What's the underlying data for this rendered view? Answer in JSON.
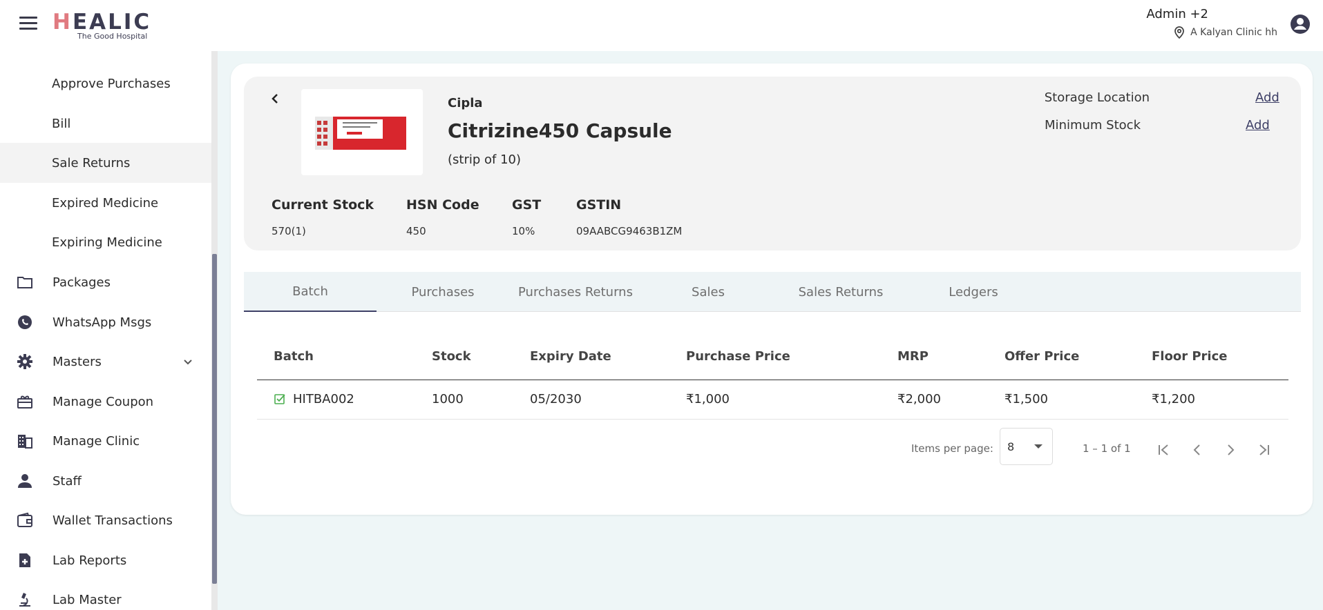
{
  "header": {
    "brand": "HEALIC",
    "tagline": "The Good Hospital",
    "user_name": "Admin +2",
    "location": "A Kalyan Clinic hh"
  },
  "sidebar": {
    "items": [
      {
        "label": "Approve Purchases",
        "icon": null
      },
      {
        "label": "Bill",
        "icon": null
      },
      {
        "label": "Sale Returns",
        "icon": null,
        "active": true
      },
      {
        "label": "Expired Medicine",
        "icon": null
      },
      {
        "label": "Expiring Medicine",
        "icon": null
      },
      {
        "label": "Packages",
        "icon": "folder-icon"
      },
      {
        "label": "WhatsApp Msgs",
        "icon": "whatsapp-icon"
      },
      {
        "label": "Masters",
        "icon": "gear-icon",
        "expandable": true
      },
      {
        "label": "Manage Coupon",
        "icon": "coupon-icon"
      },
      {
        "label": "Manage Clinic",
        "icon": "building-icon"
      },
      {
        "label": "Staff",
        "icon": "person-icon"
      },
      {
        "label": "Wallet Transactions",
        "icon": "wallet-icon"
      },
      {
        "label": "Lab Reports",
        "icon": "report-icon"
      },
      {
        "label": "Lab Master",
        "icon": "microscope-icon"
      }
    ]
  },
  "product": {
    "brand": "Cipla",
    "name": "Citrizine450 Capsule",
    "pack": "(strip of 10)",
    "storage_label": "Storage Location",
    "storage_action": "Add",
    "min_stock_label": "Minimum Stock",
    "min_stock_action": "Add",
    "info": [
      {
        "label": "Current Stock",
        "value": "570(1)"
      },
      {
        "label": "HSN Code",
        "value": "450"
      },
      {
        "label": "GST",
        "value": "10%"
      },
      {
        "label": "GSTIN",
        "value": "09AABCG9463B1ZM"
      }
    ]
  },
  "tabs": [
    {
      "label": "Batch",
      "active": true
    },
    {
      "label": "Purchases"
    },
    {
      "label": "Purchases Returns"
    },
    {
      "label": "Sales"
    },
    {
      "label": "Sales Returns"
    },
    {
      "label": "Ledgers"
    }
  ],
  "table": {
    "columns": [
      "Batch",
      "Stock",
      "Expiry Date",
      "Purchase Price",
      "MRP",
      "Offer Price",
      "Floor Price"
    ],
    "rows": [
      [
        "HITBA002",
        "1000",
        "05/2030",
        "₹1,000",
        "₹2,000",
        "₹1,500",
        "₹1,200"
      ]
    ]
  },
  "paginator": {
    "items_per_page_label": "Items per page:",
    "items_per_page": "8",
    "range": "1 – 1 of 1"
  },
  "colors": {
    "accent": "#3d3f66",
    "brand_highlight": "#e07a80",
    "check_green": "#4caf50",
    "page_bg": "#eef6f7"
  }
}
